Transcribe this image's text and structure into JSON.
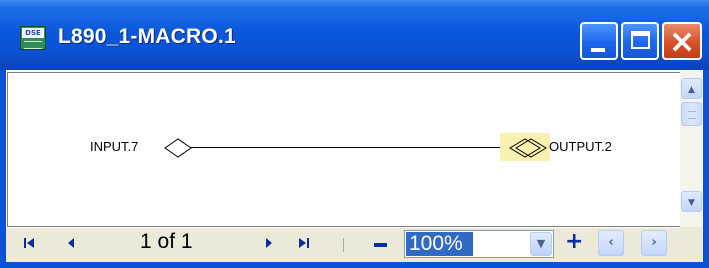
{
  "window": {
    "title": "L890_1-MACRO.1",
    "app_icon_label": "DSE",
    "buttons": {
      "minimize": "minimize",
      "maximize": "maximize",
      "close": "close"
    }
  },
  "canvas": {
    "input_port": "INPUT.7",
    "output_port": "OUTPUT.2"
  },
  "toolbar": {
    "first_glyph": "⏮",
    "prev_glyph": "◀",
    "page_indicator": "1 of 1",
    "next_glyph": "▶",
    "last_glyph": "⏭",
    "zoom_value": "100%",
    "zoom_out": "−",
    "zoom_in": "+"
  },
  "scrollbar": {
    "up_glyph": "▲",
    "down_glyph": "▼"
  },
  "colors": {
    "title_bar": "#0a52d8",
    "close_button": "#d9512a",
    "pin_highlight": "#faf0b0",
    "zoom_selection": "#316ac5"
  }
}
